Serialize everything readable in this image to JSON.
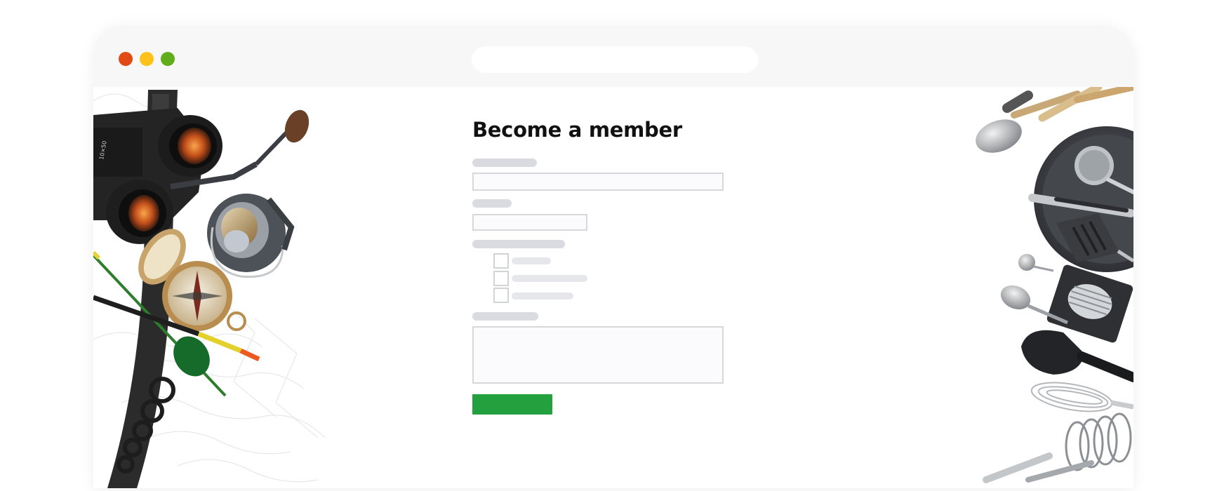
{
  "window": {
    "traffic_lights": [
      "#e14a14",
      "#fcc21a",
      "#62ad1c"
    ],
    "url": ""
  },
  "page": {
    "title": "Become a member"
  },
  "form": {
    "accent_color": "#25a03f",
    "fields": [
      {
        "type": "text",
        "label": "",
        "value": "",
        "placeholder": ""
      },
      {
        "type": "text",
        "label": "",
        "value": "",
        "placeholder": ""
      },
      {
        "type": "checkbox-group",
        "label": "",
        "options": [
          {
            "label": "",
            "checked": false
          },
          {
            "label": "",
            "checked": false
          },
          {
            "label": "",
            "checked": false
          }
        ]
      },
      {
        "type": "textarea",
        "label": "",
        "value": "",
        "placeholder": ""
      }
    ],
    "submit_label": ""
  },
  "images": {
    "left": "outdoor-gear-photo",
    "right": "kitchen-utensils-photo"
  }
}
